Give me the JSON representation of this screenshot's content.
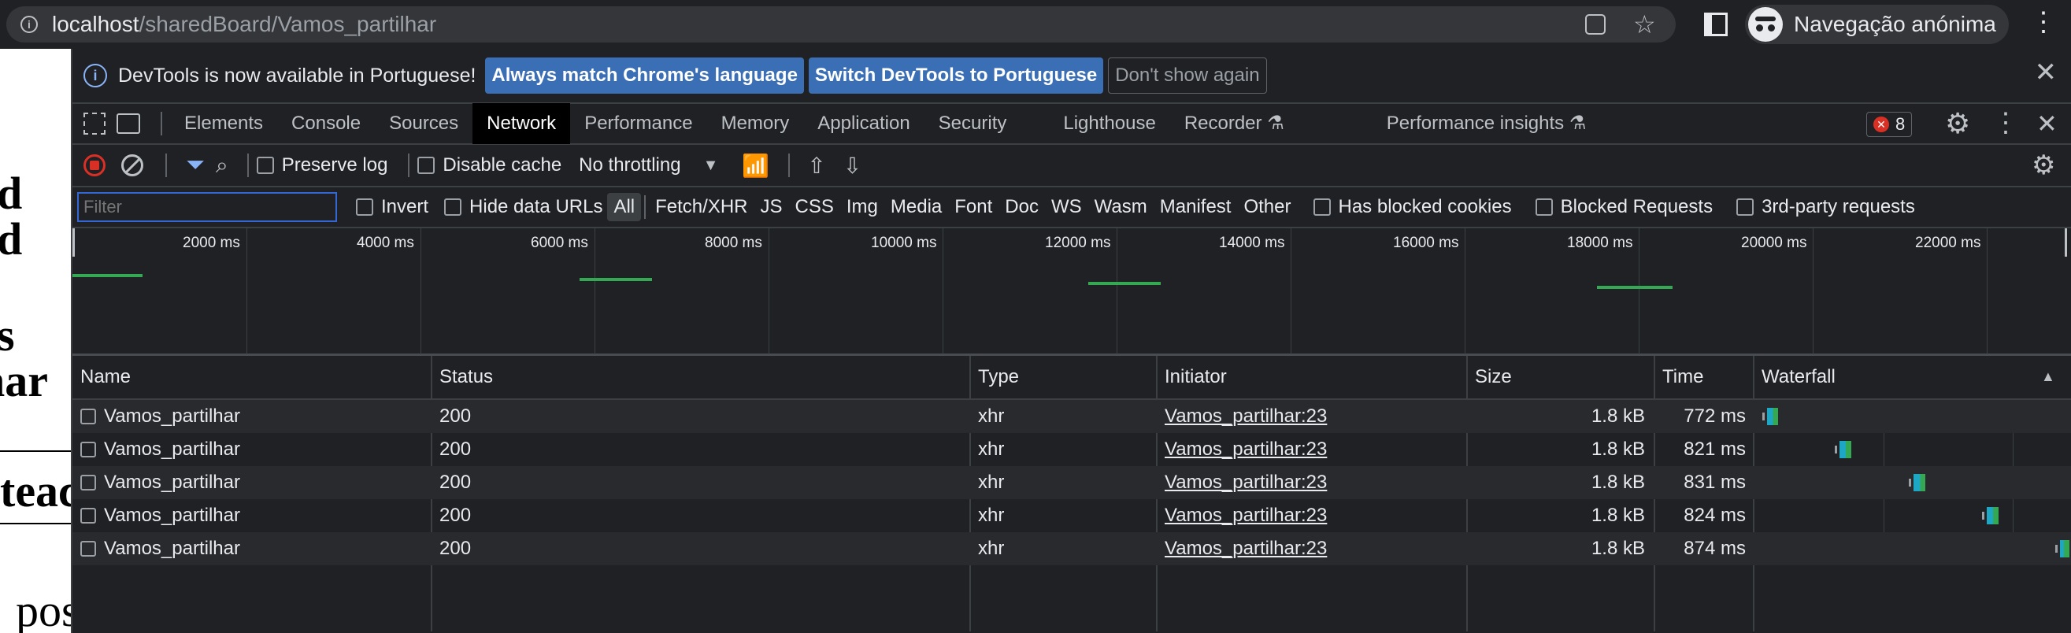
{
  "address_bar": {
    "host": "localhost",
    "path": "/sharedBoard/Vamos_partilhar",
    "incognito_label": "Navegação anónima"
  },
  "page_behind": {
    "fragments": [
      "d",
      "d",
      "s",
      "har",
      "teac",
      "pos"
    ]
  },
  "infobar": {
    "message": "DevTools is now available in Portuguese!",
    "btn_match": "Always match Chrome's language",
    "btn_switch": "Switch DevTools to Portuguese",
    "btn_dismiss": "Don't show again"
  },
  "tabs": [
    {
      "label": "Elements"
    },
    {
      "label": "Console"
    },
    {
      "label": "Sources"
    },
    {
      "label": "Network",
      "active": true
    },
    {
      "label": "Performance"
    },
    {
      "label": "Memory"
    },
    {
      "label": "Application"
    },
    {
      "label": "Security"
    },
    {
      "label": "Lighthouse"
    },
    {
      "label": "Recorder"
    },
    {
      "label": "Performance insights"
    }
  ],
  "error_count": "8",
  "toolbar": {
    "preserve_log": "Preserve log",
    "disable_cache": "Disable cache",
    "throttling": "No throttling"
  },
  "filterbar": {
    "placeholder": "Filter",
    "invert": "Invert",
    "hide_data_urls": "Hide data URLs",
    "types": [
      "All",
      "Fetch/XHR",
      "JS",
      "CSS",
      "Img",
      "Media",
      "Font",
      "Doc",
      "WS",
      "Wasm",
      "Manifest",
      "Other"
    ],
    "has_blocked_cookies": "Has blocked cookies",
    "blocked_requests": "Blocked Requests",
    "third_party": "3rd-party requests"
  },
  "overview": {
    "ticks": [
      "2000 ms",
      "4000 ms",
      "6000 ms",
      "8000 ms",
      "10000 ms",
      "12000 ms",
      "14000 ms",
      "16000 ms",
      "18000 ms",
      "20000 ms",
      "22000 ms"
    ]
  },
  "table": {
    "headers": [
      "Name",
      "Status",
      "Type",
      "Initiator",
      "Size",
      "Time",
      "Waterfall"
    ],
    "rows": [
      {
        "name": "Vamos_partilhar",
        "status": "200",
        "type": "xhr",
        "initiator": "Vamos_partilhar:23",
        "size": "1.8 kB",
        "time": "772 ms"
      },
      {
        "name": "Vamos_partilhar",
        "status": "200",
        "type": "xhr",
        "initiator": "Vamos_partilhar:23",
        "size": "1.8 kB",
        "time": "821 ms"
      },
      {
        "name": "Vamos_partilhar",
        "status": "200",
        "type": "xhr",
        "initiator": "Vamos_partilhar:23",
        "size": "1.8 kB",
        "time": "831 ms"
      },
      {
        "name": "Vamos_partilhar",
        "status": "200",
        "type": "xhr",
        "initiator": "Vamos_partilhar:23",
        "size": "1.8 kB",
        "time": "824 ms"
      },
      {
        "name": "Vamos_partilhar",
        "status": "200",
        "type": "xhr",
        "initiator": "Vamos_partilhar:23",
        "size": "1.8 kB",
        "time": "874 ms"
      }
    ]
  },
  "colors": {
    "accent_blue": "#3b6fb5",
    "record_red": "#d93025",
    "waterfall_green": "#34a853",
    "waterfall_teal": "#1ea7c5"
  }
}
